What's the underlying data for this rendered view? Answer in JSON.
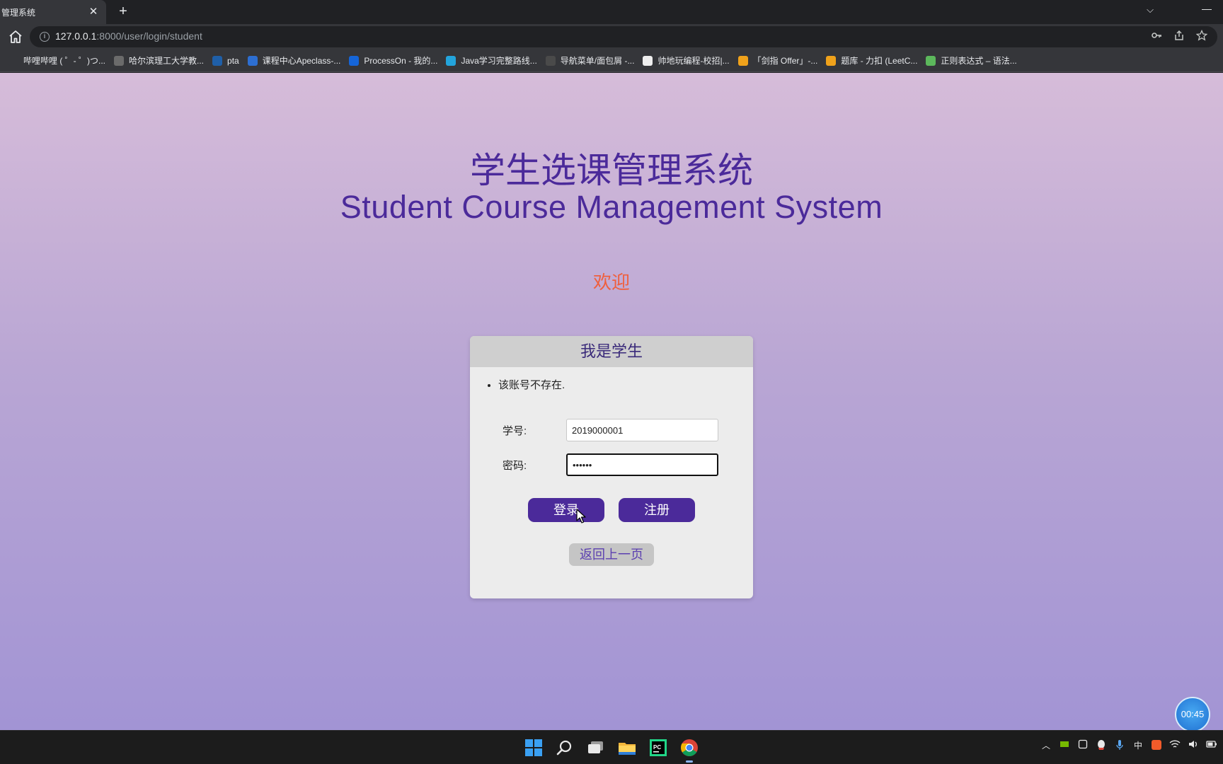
{
  "browser": {
    "tab_title": "管理系统",
    "close_tab": "✕",
    "new_tab": "+",
    "tab_search": "⌵",
    "minimize": "—",
    "url_host": "127.0.0.1",
    "url_path": ":8000/user/login/student",
    "omnibox_icons": [
      "key-icon",
      "share-icon",
      "star-icon"
    ]
  },
  "bookmarks": [
    {
      "label": "哔哩哔哩 ( ゜- ゜)つ...",
      "icon": "bilibili-icon",
      "color": "#35363a"
    },
    {
      "label": "哈尔滨理工大学教...",
      "icon": "globe-icon",
      "color": "#6b6b6b"
    },
    {
      "label": "pta",
      "icon": "pta-icon",
      "color": "#1f5fa8"
    },
    {
      "label": "课程中心Apeclass-...",
      "icon": "ape-icon",
      "color": "#2d6fd2"
    },
    {
      "label": "ProcessOn - 我的...",
      "icon": "processon-icon",
      "color": "#1565d8"
    },
    {
      "label": "Java学习完整路线...",
      "icon": "bilibili-tv-icon",
      "color": "#23a4dc"
    },
    {
      "label": "导航菜单/面包屑 -...",
      "icon": "element-icon",
      "color": "#4a4a4a"
    },
    {
      "label": "帅地玩编程-校招|...",
      "icon": "page-icon",
      "color": "#eeeeee"
    },
    {
      "label": "「剑指 Offer」-...",
      "icon": "leetcode-icon",
      "color": "#f0a21b"
    },
    {
      "label": "题库 - 力扣 (LeetC...",
      "icon": "leetcode-icon",
      "color": "#f0a21b"
    },
    {
      "label": "正则表达式 – 语法...",
      "icon": "runoob-icon",
      "color": "#5cb85c"
    }
  ],
  "page": {
    "title_cn": "学生选课管理系统",
    "title_en": "Student Course Management System",
    "welcome": "欢迎"
  },
  "login_card": {
    "header": "我是学生",
    "error": "该账号不存在.",
    "id_label": "学号:",
    "id_value": "2019000001",
    "password_label": "密码:",
    "password_value": "••••••",
    "login_button": "登录",
    "register_button": "注册",
    "back_button": "返回上一页"
  },
  "timer": "00:45",
  "taskbar": {
    "apps": [
      "windows-start-icon",
      "search-icon",
      "task-view-icon",
      "file-explorer-icon",
      "pycharm-icon",
      "chrome-icon"
    ],
    "tray_ime": "中"
  },
  "colors": {
    "accent": "#4b2a9a",
    "welcome": "#ef5f3e",
    "gradient_top": "#d6bcd9",
    "gradient_bottom": "#a294d4"
  }
}
